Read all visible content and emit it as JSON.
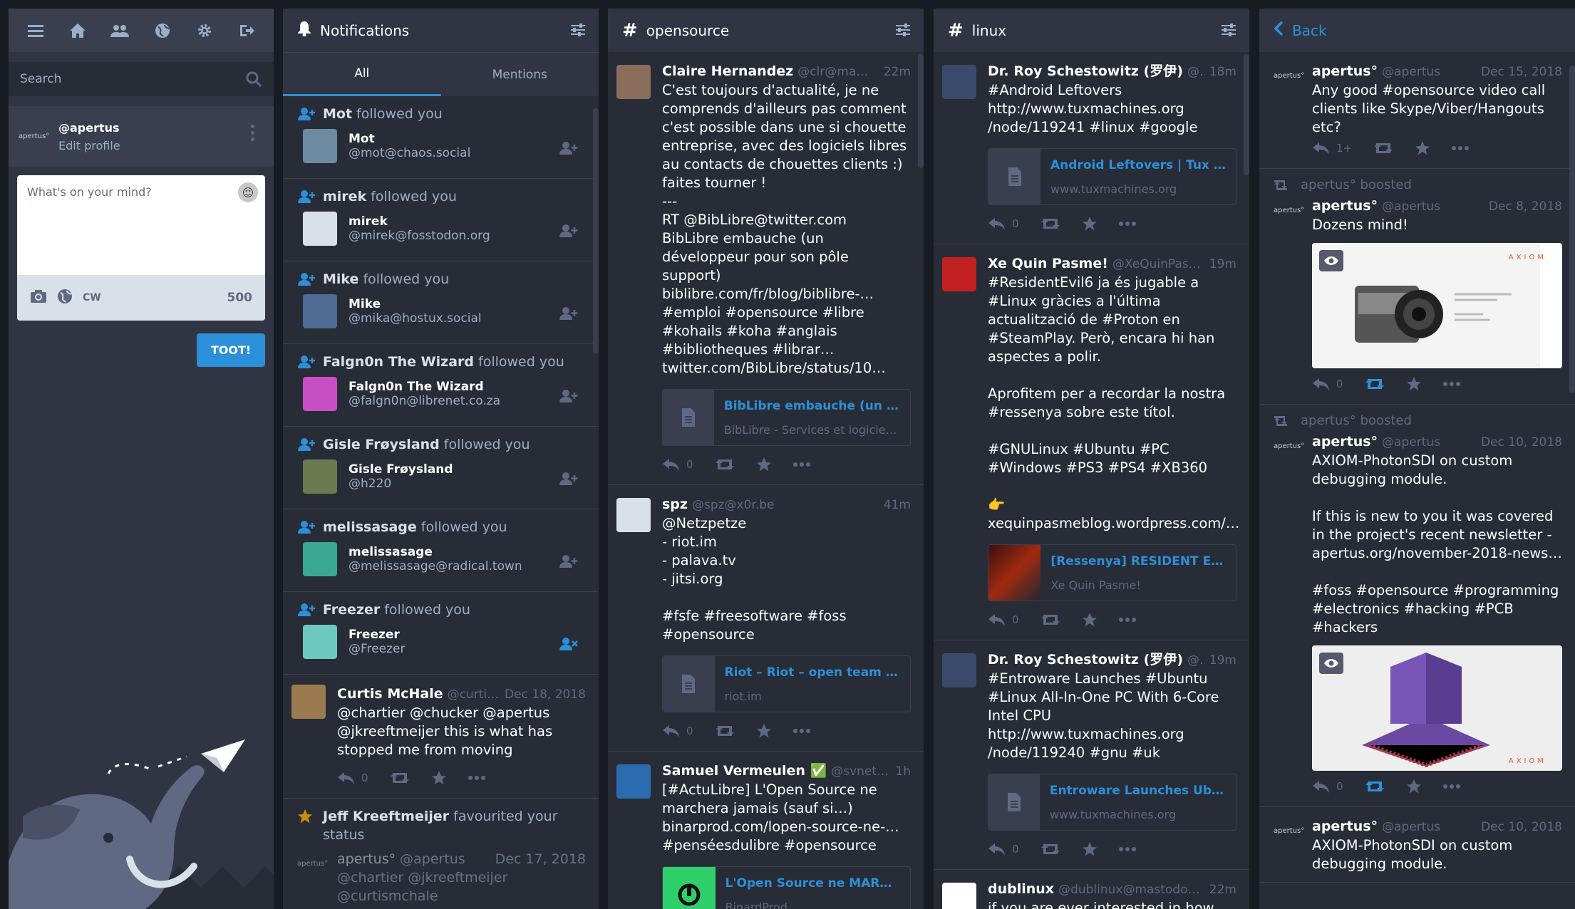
{
  "compose": {
    "search_placeholder": "Search",
    "account": {
      "logo": "apertus°",
      "username": "@apertus",
      "edit_profile": "Edit profile"
    },
    "placeholder": "What's on your mind?",
    "cw_label": "CW",
    "char_count": "500",
    "toot_label": "TOOT!",
    "nav_icons": [
      "menu-icon",
      "home-icon",
      "people-icon",
      "globe-icon",
      "gear-icon",
      "logout-icon"
    ]
  },
  "notifications": {
    "title": "Notifications",
    "tabs": [
      "All",
      "Mentions"
    ],
    "followed_suffix": "followed you",
    "follows": [
      {
        "name": "Mot",
        "display": "Mot",
        "handle": "@mot@chaos.social",
        "color": "#6e8aa0"
      },
      {
        "name": "mirek",
        "display": "mirek",
        "handle": "@mirek@fosstodon.org",
        "color": "#d9e1e8"
      },
      {
        "name": "Mike",
        "display": "Mike",
        "handle": "@mika@hostux.social",
        "color": "#4f6b94"
      },
      {
        "name": "Falgn0n The Wizard",
        "display": "Falgn0n The Wizard",
        "handle": "@falgn0n@librenet.co.za",
        "color": "#c64fc3"
      },
      {
        "name": "Gisle Frøysland",
        "display": "Gisle Frøysland",
        "handle": "@h220",
        "color": "#6b7a4f"
      },
      {
        "name": "melissasage",
        "display": "melissasage",
        "handle": "@melissasage@radical.town",
        "color": "#3aa890"
      },
      {
        "name": "Freezer",
        "display": "Freezer",
        "handle": "@Freezer",
        "color": "#6ec8c2"
      }
    ],
    "status": {
      "name": "Curtis McHale",
      "handle": "@curtism...",
      "time": "Dec 18, 2018",
      "text": "@chartier @chucker @apertus @jkreeftmeijer this is what has stopped me from moving",
      "replies": "0"
    },
    "fav": {
      "line_name": "Jeff Kreeftmeijer",
      "line_rest": "favourited your status",
      "name": "apertus°",
      "handle": "@apertus",
      "time": "Dec 17, 2018",
      "text": "@chartier @jkreeftmeijer @curtismchale"
    }
  },
  "opensource": {
    "title": "opensource",
    "statuses": [
      {
        "name": "Claire Hernandez",
        "handle": "@clr@mamot.fr",
        "time": "22m",
        "text": "C'est toujours d'actualité, je ne comprends d'ailleurs pas comment c'est possible dans une si chouette entreprise, avec des logiciels libres au contacts de chouettes clients :) faites tourner !\n---\nRT @BibLibre@twitter.com\nBibLibre embauche (un développeur pour son pôle support)\nbiblibre.com/fr/blog/biblibre-…\n#emploi #opensource #libre\n#kohails #koha #anglais\n#bibliotheques #librar…\ntwitter.com/BibLibre/status/10…",
        "card_title": "BibLibre embauche (un dé…",
        "card_sub": "BibLibre - Services et logicie…",
        "replies": "0"
      },
      {
        "name": "spz",
        "handle": "@spz@x0r.be",
        "time": "41m",
        "text": "@Netzpetze\n- riot.im\n- palava.tv\n- jitsi.org\n\n#fsfe #freesoftware #foss\n#opensource",
        "card_title": "Riot – Riot – open team co…",
        "card_sub": "riot.im",
        "replies": "0"
      },
      {
        "name": "Samuel Vermeulen ✅",
        "handle": "@svnetli...",
        "time": "1h",
        "text": "[#ActuLibre] L'Open Source ne marchera jamais (sauf si…)\nbinarprod.com/lopen-source-ne-…\n#penséesdulibre #opensource",
        "card_title": "L'Open Source ne MARCH…",
        "card_sub": "BinardProd"
      }
    ]
  },
  "linux": {
    "title": "linux",
    "statuses": [
      {
        "name": "Dr. Roy Schestowitz (罗伊)",
        "handle": "@sc...",
        "time": "18m",
        "text": "#Android Leftovers\nhttp://www.tuxmachines.org\n/node/119241 #linux #google",
        "card_title": "Android Leftovers | Tux M…",
        "card_sub": "www.tuxmachines.org",
        "replies": "0"
      },
      {
        "name": "Xe Quin Pasme!",
        "handle": "@XeQuinPasme...",
        "time": "19m",
        "text": "#ResidentEvil6 ja és jugable a #Linux gràcies a l'última actualització de #Proton en #SteamPlay. Però, encara hi han aspectes a polir.\n\nAprofitem per a recordar la nostra #ressenya sobre este títol.\n\n#GNULinux #Ubuntu #PC\n#Windows #PS3 #PS4 #XB360\n\n👉\nxequinpasmeblog.wordpress.com/…",
        "card_title": "[Ressenya] RESIDENT EVI…",
        "card_sub": "Xe Quin Pasme!",
        "replies": "0"
      },
      {
        "name": "Dr. Roy Schestowitz (罗伊)",
        "handle": "@sc...",
        "time": "19m",
        "text": "#Entroware Launches #Ubuntu #Linux All-In-One PC With 6-Core Intel CPU\nhttp://www.tuxmachines.org\n/node/119240 #gnu #uk",
        "card_title": "Entroware Launches Ubun…",
        "card_sub": "www.tuxmachines.org",
        "replies": "0"
      },
      {
        "name": "dublinux",
        "handle": "@dublinux@mastodon.t...",
        "time": "22m",
        "text": "if you are ever interested in how"
      }
    ]
  },
  "detail": {
    "back_label": "Back",
    "boosted_label": "apertus° boosted",
    "statuses": [
      {
        "name": "apertus°",
        "handle": "@apertus",
        "time": "Dec 15, 2018",
        "text": "Any good #opensource video call clients like Skype/Viber/Hangouts etc?",
        "replies": "1+"
      },
      {
        "name": "apertus°",
        "handle": "@apertus",
        "time": "Dec 8, 2018",
        "text": "Dozens mind!",
        "replies": "0",
        "media_brand": "AXIOM"
      },
      {
        "name": "apertus°",
        "handle": "@apertus",
        "time": "Dec 10, 2018",
        "text": "AXIOM-PhotonSDI on custom debugging module.\n\nIf this is new to you it was covered in the project's recent newsletter - apertus.org/november-2018-news…\n\n#foss #opensource #programming #electronics #hacking #PCB #hackers",
        "replies": "0",
        "media_brand": "AXIOM"
      },
      {
        "name": "apertus°",
        "handle": "@apertus",
        "time": "Dec 10, 2018",
        "text": "AXIOM-PhotonSDI on custom debugging module."
      }
    ]
  }
}
